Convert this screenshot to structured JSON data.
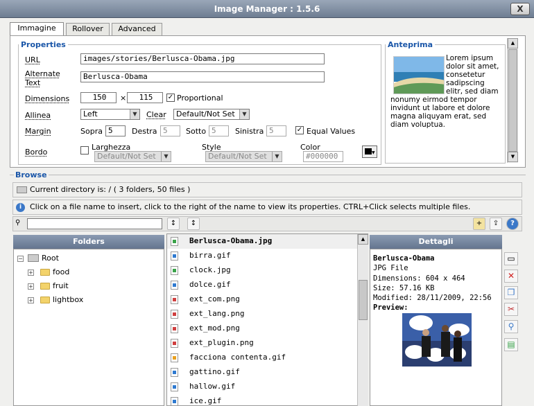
{
  "window": {
    "title": "Image Manager : 1.5.6",
    "close_label": "X"
  },
  "tabs": [
    "Immagine",
    "Rollover",
    "Advanced"
  ],
  "properties": {
    "legend": "Properties",
    "url_label": "URL",
    "url_value": "images/stories/Berlusca-Obama.jpg",
    "alt_label_1": "Alternate",
    "alt_label_2": "Text",
    "alt_value": "Berlusca-Obama",
    "dimensions_label": "Dimensions",
    "width": "150",
    "times": "×",
    "height": "115",
    "proportional_label": "Proportional",
    "align_label": "Allinea",
    "align_value": "Left",
    "clear_label": "Clear",
    "clear_value": "Default/Not Set",
    "margin_label": "Margin",
    "sopra_label": "Sopra",
    "sopra_value": "5",
    "destra_label": "Destra",
    "destra_value": "5",
    "sotto_label": "Sotto",
    "sotto_value": "5",
    "sinistra_label": "Sinistra",
    "sinistra_value": "5",
    "equal_label": "Equal Values",
    "border_label": "Bordo",
    "larghezza_label": "Larghezza",
    "larghezza_value": "Default/Not Set",
    "style_label": "Style",
    "style_value": "Default/Not Set",
    "color_label": "Color",
    "color_value": "#000000"
  },
  "preview": {
    "legend": "Anteprima",
    "text": "Lorem ipsum dolor sit amet, consetetur sadipscing elitr, sed diam nonumy eirmod tempor invidunt ut labore et dolore magna aliquyam erat, sed diam voluptua."
  },
  "browse": {
    "legend": "Browse",
    "current_dir": "Current directory is: / ( 3 folders, 50 files )",
    "help": "Click on a file name to insert, click to the right of the name to view its properties. CTRL+Click selects multiple files.",
    "search_value": "",
    "folders_header": "Folders",
    "details_header": "Dettagli",
    "tree": {
      "root": "Root",
      "children": [
        "food",
        "fruit",
        "lightbox"
      ]
    },
    "files": [
      {
        "name": "Berlusca-Obama.jpg",
        "type": "jpg"
      },
      {
        "name": "birra.gif",
        "type": "gif"
      },
      {
        "name": "clock.jpg",
        "type": "jpg"
      },
      {
        "name": "dolce.gif",
        "type": "gif"
      },
      {
        "name": "ext_com.png",
        "type": "png"
      },
      {
        "name": "ext_lang.png",
        "type": "png"
      },
      {
        "name": "ext_mod.png",
        "type": "png"
      },
      {
        "name": "ext_plugin.png",
        "type": "png"
      },
      {
        "name": "facciona contenta.gif",
        "type": "warn"
      },
      {
        "name": "gattino.gif",
        "type": "gif"
      },
      {
        "name": "hallow.gif",
        "type": "gif"
      },
      {
        "name": "ice.gif",
        "type": "gif"
      }
    ],
    "details": {
      "name": "Berlusca-Obama",
      "type": "JPG File",
      "dimensions": "Dimensions: 604 x 464",
      "size": "Size: 57.16 KB",
      "modified": "Modified: 28/11/2009, 22:56",
      "preview_label": "Preview:"
    }
  },
  "colors": {
    "legend": "#1a56a8",
    "header": "#64758f",
    "jpg": "#3aa34a",
    "png": "#d04040",
    "gif": "#2f7ad0",
    "warn": "#e8a020"
  }
}
